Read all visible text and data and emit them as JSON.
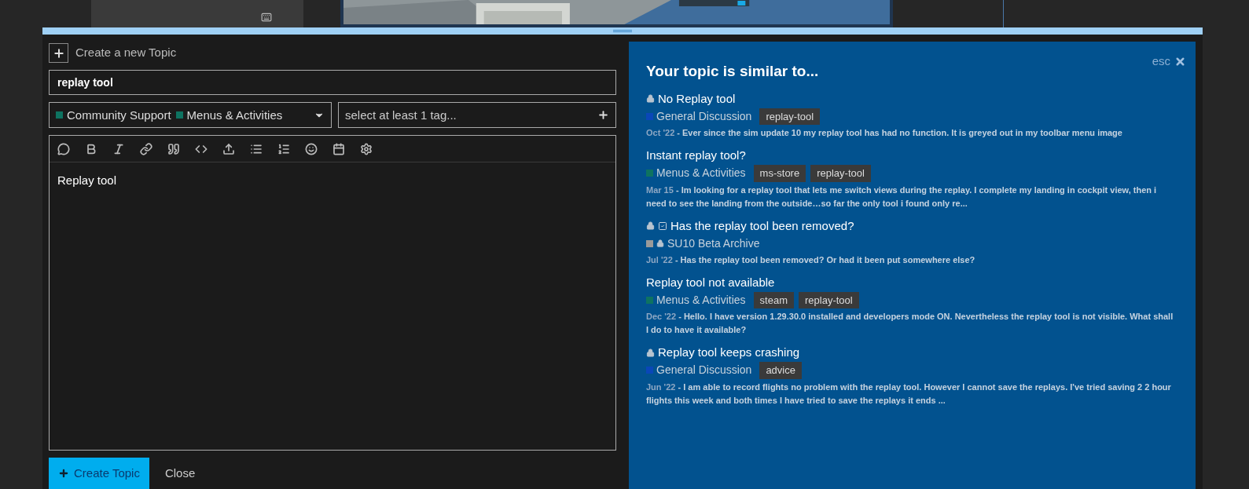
{
  "composer": {
    "heading": "Create a new Topic",
    "title_value": "replay tool",
    "categories": [
      {
        "name": "Community Support",
        "color": "#0e7361"
      },
      {
        "name": "Menus & Activities",
        "color": "#0e7361"
      }
    ],
    "tag_placeholder": "select at least 1 tag...",
    "body": "Replay tool",
    "create_button": "Create Topic",
    "close_button": "Close"
  },
  "similar": {
    "heading": "Your topic is similar to...",
    "dismiss": "esc",
    "topics": [
      {
        "title": "No Replay tool",
        "locked": true,
        "solved": false,
        "category": {
          "name": "General Discussion",
          "color": "#0a47b8",
          "locked": false
        },
        "tags": [
          "replay-tool"
        ],
        "date": "Oct '22",
        "excerpt": "- Ever since the sim update 10 my replay tool has had no function. It is greyed out in my toolbar menu image"
      },
      {
        "title": "Instant replay tool?",
        "locked": false,
        "solved": false,
        "category": {
          "name": "Menus & Activities",
          "color": "#0e7361",
          "locked": false
        },
        "tags": [
          "ms-store",
          "replay-tool"
        ],
        "date": "Mar 15",
        "excerpt": "- Im looking for a replay tool that lets me switch views during the replay. I complete my landing in cockpit view, then i need to see the landing from the outside…so far the only tool i found only re..."
      },
      {
        "title": "Has the replay tool been removed?",
        "locked": true,
        "solved": true,
        "category": {
          "name": "SU10 Beta Archive",
          "color": "#9a9a9a",
          "locked": true
        },
        "date": "Jul '22",
        "excerpt": "- Has the replay tool been removed? Or had it been put somewhere else?"
      },
      {
        "title": "Replay tool not available",
        "locked": false,
        "solved": false,
        "category": {
          "name": "Menus & Activities",
          "color": "#0e7361",
          "locked": false
        },
        "tags": [
          "steam",
          "replay-tool"
        ],
        "date": "Dec '22",
        "excerpt": "- Hello. I have version 1.29.30.0 installed and developers mode ON. Nevertheless the replay tool is not visible. What shall I do to have it available?"
      },
      {
        "title": "Replay tool keeps crashing",
        "locked": true,
        "solved": false,
        "category": {
          "name": "General Discussion",
          "color": "#0a47b8",
          "locked": false
        },
        "tags": [
          "advice"
        ],
        "date": "Jun '22",
        "excerpt": "- I am able to record flights no problem with the replay tool. However I cannot save the replays. I've tried saving 2 2 hour flights this week and both times I have tried to save the replays it ends ..."
      }
    ]
  }
}
